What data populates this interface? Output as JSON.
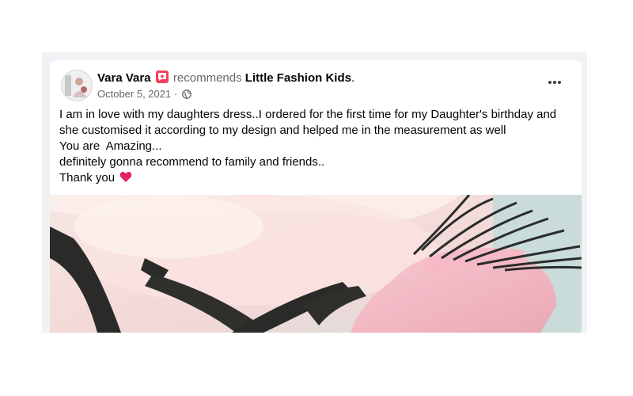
{
  "post": {
    "author": "Vara Vara",
    "action": "recommends",
    "page": "Little Fashion Kids",
    "period": ".",
    "date": "October 5, 2021 ·",
    "body_lines": [
      "I am in love with my daughters dress..I ordered for the first time for my Daughter's birthday and",
      "she customised it according to my design and helped me in the measurement as well",
      "You are  Amazing...",
      "definitely gonna recommend to family and friends..",
      "Thank you"
    ]
  },
  "icons": {
    "badge": "recommendation-badge-icon",
    "privacy": "globe-icon",
    "more": "more-options-icon",
    "heart": "red-heart-icon"
  },
  "colors": {
    "badge": "#f3425f",
    "secondary_text": "#65676b",
    "heart": "#e0245e"
  }
}
